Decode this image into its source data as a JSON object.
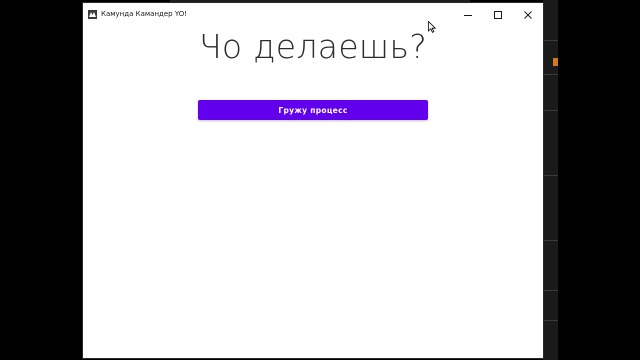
{
  "window": {
    "title": "Камунда Камандер YO!"
  },
  "main": {
    "heading": "Чо делаешь?",
    "primary_button_label": "Гружу процесс"
  },
  "colors": {
    "accent": "#6200ee",
    "window_bg": "#ffffff",
    "desktop_bg": "#000000"
  },
  "icons": {
    "app": "app-logo-icon",
    "minimize": "minimize-icon",
    "maximize": "maximize-icon",
    "close": "close-icon",
    "cursor": "mouse-cursor-icon"
  }
}
